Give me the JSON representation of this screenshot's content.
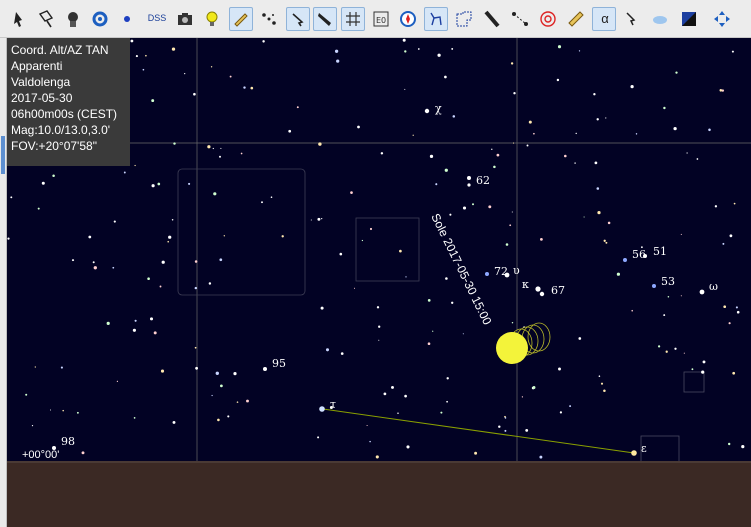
{
  "toolbar": {
    "buttons": [
      {
        "name": "cursor-pointer",
        "icon": "arrow-pointer-icon"
      },
      {
        "name": "pointer-box",
        "icon": "pointer-box-icon"
      },
      {
        "name": "mode-dark-figure",
        "icon": "head-silhouette-icon"
      },
      {
        "name": "sync",
        "icon": "sync-icon"
      },
      {
        "name": "dot",
        "icon": "blue-dot-icon"
      },
      {
        "name": "dss",
        "label": "DSS"
      },
      {
        "name": "camera",
        "icon": "camera-icon"
      },
      {
        "name": "bulb",
        "icon": "lightbulb-icon"
      },
      {
        "name": "pencil",
        "icon": "pencil-icon"
      },
      {
        "name": "stars",
        "icon": "stars-icon"
      },
      {
        "name": "select",
        "icon": "select-arrow-icon"
      },
      {
        "name": "telescope",
        "icon": "telescope-icon"
      },
      {
        "name": "grid",
        "icon": "grid-icon"
      },
      {
        "name": "eq-grid",
        "icon": "eq-grid-icon"
      },
      {
        "name": "compass",
        "icon": "compass-icon"
      },
      {
        "name": "constellation",
        "icon": "constellation-icon"
      },
      {
        "name": "boundaries",
        "icon": "boundaries-icon"
      },
      {
        "name": "milky-way",
        "icon": "milky-way-icon"
      },
      {
        "name": "ecliptic",
        "icon": "ecliptic-icon"
      },
      {
        "name": "target",
        "icon": "target-icon"
      },
      {
        "name": "ruler",
        "icon": "ruler-icon"
      },
      {
        "name": "alpha",
        "label": "α"
      },
      {
        "name": "alpha-cursor",
        "icon": "alpha-cursor-icon"
      },
      {
        "name": "cloud",
        "icon": "cloud-icon"
      },
      {
        "name": "contrast",
        "icon": "contrast-icon"
      },
      {
        "name": "move",
        "icon": "move-arrows-icon"
      }
    ]
  },
  "info": {
    "projection": "Coord. Alt/AZ TAN",
    "mode": "Apparenti",
    "location": "Valdolenga",
    "date": "2017-05-30",
    "time": "06h00m00s (CEST)",
    "magnitude": "Mag:10.0/13.0,3.0'",
    "fov": "FOV:+20°07'58\""
  },
  "sky": {
    "star_labels": {
      "chi": "χ",
      "n62": "62",
      "n72": "72",
      "upsilon": "υ",
      "kappa": "κ",
      "n67": "67",
      "n56": "56",
      "n51": "51",
      "n53": "53",
      "omega": "ω",
      "n95": "95",
      "tau": "τ",
      "epsilon": "ε",
      "n98": "98"
    },
    "sun_label": "Sole 2017-05-30 15:00",
    "declination_label": "+00°00'"
  },
  "colors": {
    "sky": "#020224",
    "grid": "#6b6b6b",
    "sun": "#f3f33a",
    "trail": "#8aa000",
    "info_bg": "#3a3a3a",
    "bottom": "#3b2924"
  }
}
